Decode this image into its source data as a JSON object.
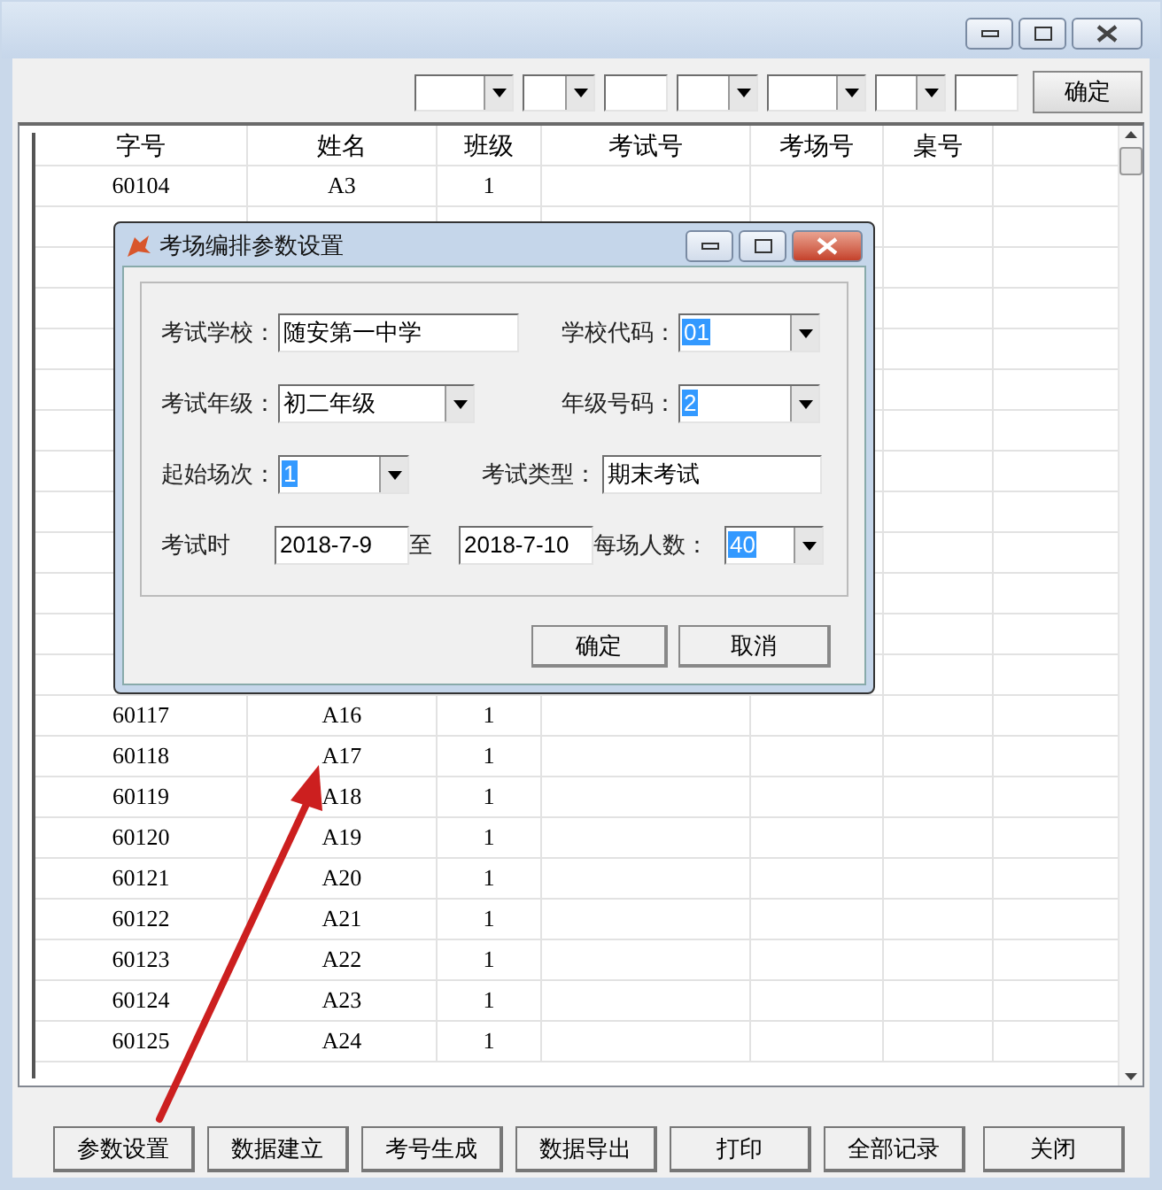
{
  "toolbar": {
    "controls": [
      {
        "kind": "combo"
      },
      {
        "kind": "combo"
      },
      {
        "kind": "text"
      },
      {
        "kind": "combo"
      },
      {
        "kind": "combo"
      },
      {
        "kind": "combo"
      },
      {
        "kind": "text"
      }
    ],
    "button": "确定"
  },
  "table": {
    "columns": [
      "字号",
      "姓名",
      "班级",
      "考试号",
      "考场号",
      "桌号"
    ],
    "rows": [
      [
        "60104",
        "A3",
        "1"
      ],
      [
        "60117",
        "A16",
        "1"
      ],
      [
        "60118",
        "A17",
        "1"
      ],
      [
        "60119",
        "A18",
        "1"
      ],
      [
        "60120",
        "A19",
        "1"
      ],
      [
        "60121",
        "A20",
        "1"
      ],
      [
        "60122",
        "A21",
        "1"
      ],
      [
        "60123",
        "A22",
        "1"
      ],
      [
        "60124",
        "A23",
        "1"
      ],
      [
        "60125",
        "A24",
        "1"
      ]
    ]
  },
  "dialog": {
    "title": "考场编排参数设置",
    "rows": [
      [
        {
          "kind": "label",
          "text": "考试学校："
        },
        {
          "kind": "text",
          "value": "随安第一中学"
        },
        {
          "kind": "gap"
        },
        {
          "kind": "label",
          "text": "学校代码："
        },
        {
          "kind": "combo",
          "value": "01",
          "text_selected": true
        }
      ],
      [
        {
          "kind": "label",
          "text": "考试年级："
        },
        {
          "kind": "combo",
          "value": "初二年级",
          "text_selected": false
        },
        {
          "kind": "gap"
        },
        {
          "kind": "label",
          "text": "年级号码："
        },
        {
          "kind": "combo",
          "value": "2",
          "text_selected": true
        }
      ],
      [
        {
          "kind": "label",
          "text": "起始场次："
        },
        {
          "kind": "combo",
          "value": "1",
          "text_selected": true
        },
        {
          "kind": "gap"
        },
        {
          "kind": "label",
          "text": "考试类型："
        },
        {
          "kind": "text",
          "value": "期末考试"
        }
      ],
      [
        {
          "kind": "label",
          "text": "考试时"
        },
        {
          "kind": "text",
          "value": "2018-7-9"
        },
        {
          "kind": "label",
          "text": "至"
        },
        {
          "kind": "text",
          "value": "2018-7-10"
        },
        {
          "kind": "label",
          "text": "每场人数："
        },
        {
          "kind": "combo",
          "value": "40",
          "text_selected": true
        }
      ]
    ],
    "buttons": [
      "确定",
      "取消"
    ]
  },
  "bottom_buttons": [
    "参数设置",
    "数据建立",
    "考号生成",
    "数据导出",
    "打印",
    "全部记录",
    "关闭"
  ]
}
